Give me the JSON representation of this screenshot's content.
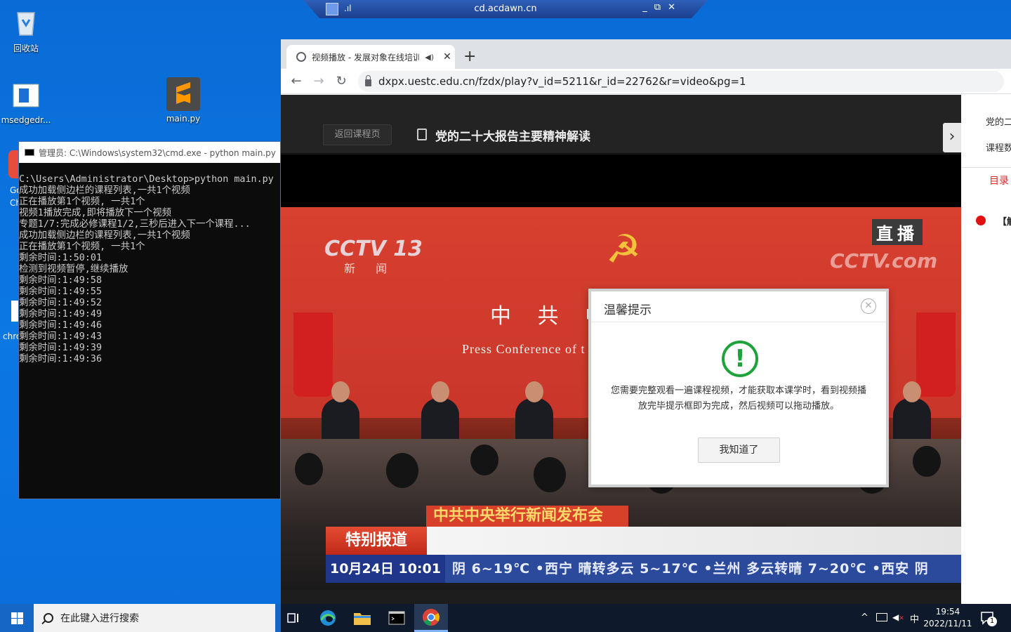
{
  "remote_bar": {
    "title": "cd.acdawn.cn",
    "signal": ".ıl",
    "minimize": "_",
    "restore": "⧉",
    "close": "✕"
  },
  "desktop": {
    "icons": [
      {
        "label": "回收站"
      },
      {
        "label": "msedgedr..."
      },
      {
        "label": "main.py"
      }
    ],
    "partial_labels": [
      "Go",
      "Ch",
      "chro"
    ]
  },
  "cmd": {
    "title": "管理员: C:\\Windows\\system32\\cmd.exe - python  main.py",
    "lines": [
      "C:\\Users\\Administrator\\Desktop>python main.py",
      "成功加载侧边栏的课程列表,一共1个视频",
      "正在播放第1个视频, 一共1个",
      "视频1播放完成,即将播放下一个视频",
      "专题1/7:完成必修课程1/2,三秒后进入下一个课程...",
      "成功加载侧边栏的课程列表,一共1个视频",
      "正在播放第1个视频, 一共1个",
      "剩余时间:1:50:01",
      "检测到视频暂停,继续播放",
      "剩余时间:1:49:58",
      "剩余时间:1:49:55",
      "剩余时间:1:49:52",
      "剩余时间:1:49:49",
      "剩余时间:1:49:46",
      "剩余时间:1:49:43",
      "剩余时间:1:49:39",
      "剩余时间:1:49:36"
    ]
  },
  "browser": {
    "tab_title": "视频播放 - 发展对象在线培训",
    "tab_close": "✕",
    "new_tab": "+",
    "url": "dxpx.uestc.edu.cn/fzdx/play?v_id=5211&r_id=22762&r=video&pg=1",
    "back": "←",
    "forward": "→",
    "reload": "↻"
  },
  "page": {
    "back_button": "返回课程页",
    "course_title": "党的二十大报告主要精神解读",
    "side_toggle": "›",
    "side": {
      "line1": "党的二",
      "line2": "课程数",
      "menu": "目录",
      "item": "【解"
    }
  },
  "video": {
    "cctv_logo": "CCTV 13",
    "cctv_sub": "新 闻",
    "live_badge": "直播",
    "cctv_com": "CCTV.com",
    "big_text": "中 共 中 央",
    "press_text": "Press Conference of t",
    "news_headline": "中共中央举行新闻发布会",
    "special_report": "特别报道",
    "ticker_time": "10月24日 10:01",
    "ticker_weather": "阴 6~19℃ •西宁 晴转多云 5~17℃ •兰州 多云转晴 7~20℃ •西安 阴"
  },
  "modal": {
    "title": "温馨提示",
    "close": "✕",
    "icon": "!",
    "message": "您需要完整观看一遍课程视频，才能获取本课学时，看到视频播放完毕提示框即为完成，然后视频可以拖动播放。",
    "button": "我知道了"
  },
  "taskbar": {
    "search_placeholder": "在此键入进行搜索",
    "tray_chevron": "^",
    "tray_ime": "中",
    "time": "19:54",
    "date": "2022/11/11",
    "notification_count": "1"
  }
}
